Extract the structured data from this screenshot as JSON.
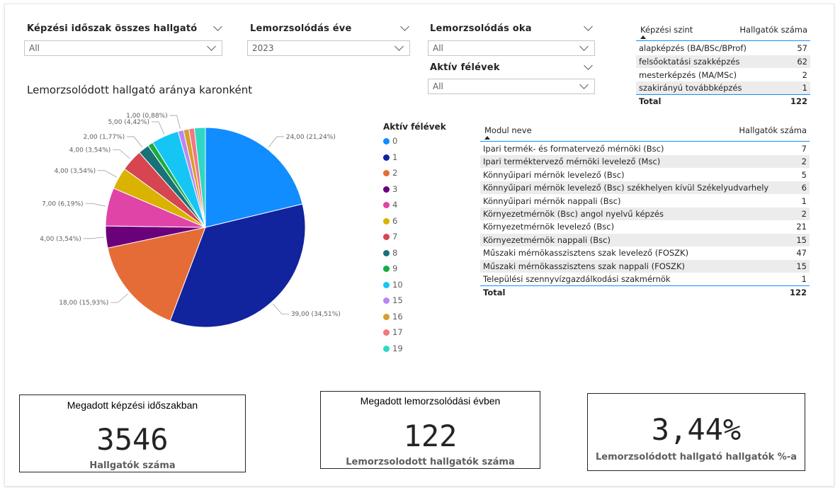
{
  "slicers": {
    "period": {
      "title": "Képzési időszak összes hallgató",
      "value": "All"
    },
    "year": {
      "title": "Lemorzsolódás éve",
      "value": "2023"
    },
    "reason": {
      "title": "Lemorzsolódás oka",
      "value": "All"
    },
    "active": {
      "title": "Aktív félévek",
      "value": "All"
    }
  },
  "level_table": {
    "col1": "Képzési szint",
    "col2": "Hallgatók száma",
    "rows": [
      {
        "name": "alapképzés (BA/BSc/BProf)",
        "value": "57"
      },
      {
        "name": "felsőoktatási szakképzés",
        "value": "62"
      },
      {
        "name": "mesterképzés (MA/MSc)",
        "value": "2"
      },
      {
        "name": "szakirányú továbbképzés",
        "value": "1"
      }
    ],
    "total_label": "Total",
    "total_value": "122"
  },
  "module_table": {
    "col1": "Modul neve",
    "col2": "Hallgatók száma",
    "rows": [
      {
        "name": "Ipari termék- és formatervező mérnöki (Bsc)",
        "value": "7"
      },
      {
        "name": "Ipari terméktervező mérnöki levelező (Msc)",
        "value": "2"
      },
      {
        "name": "Könnyűipari mérnök levelező (Bsc)",
        "value": "5"
      },
      {
        "name": "Könnyűipari mérnök levelező (Bsc) székhelyen kívül Székelyudvarhely",
        "value": "6"
      },
      {
        "name": "Könnyűipari mérnök nappali (Bsc)",
        "value": "1"
      },
      {
        "name": "Környezetmérnök (Bsc) angol nyelvű képzés",
        "value": "2"
      },
      {
        "name": "Környezetmérnök levelező (Bsc)",
        "value": "21"
      },
      {
        "name": "Környezetmérnök nappali (Bsc)",
        "value": "15"
      },
      {
        "name": "Műszaki mérnökasszisztens szak levelező (FOSZK)",
        "value": "47"
      },
      {
        "name": "Műszaki mérnökasszisztens szak nappali (FOSZK)",
        "value": "15"
      },
      {
        "name": "Települési szennyvízgazdálkodási szakmérnök",
        "value": "1"
      }
    ],
    "total_label": "Total",
    "total_value": "122"
  },
  "cards": {
    "c1": {
      "title": "Megadott képzési időszakban",
      "value": "3546",
      "subtitle": "Hallgatók száma"
    },
    "c2": {
      "title": "Megadott lemorzsolódási évben",
      "value": "122",
      "subtitle": "Lemorzsolodott hallgatók száma"
    },
    "c3": {
      "value": "3,44%",
      "subtitle": "Lemorzsolódott hallgató hallgatók %-a"
    }
  },
  "chart_data": {
    "type": "pie",
    "title": "Lemorzsolódott hallgató aránya karonként",
    "legend_title": "Aktív félévek",
    "legend_position": "right",
    "slices": [
      {
        "name": "0",
        "value": 24,
        "label": "24,00 (21,24%)",
        "color": "#118DFF"
      },
      {
        "name": "1",
        "value": 39,
        "label": "39,00 (34,51%)",
        "color": "#12239E"
      },
      {
        "name": "2",
        "value": 18,
        "label": "18,00 (15,93%)",
        "color": "#E66C37"
      },
      {
        "name": "3",
        "value": 4,
        "label": "4,00 (3,54%)",
        "color": "#6B007B"
      },
      {
        "name": "4",
        "value": 7,
        "label": "7,00 (6,19%)",
        "color": "#E044A7"
      },
      {
        "name": "6",
        "value": 4,
        "label": "4,00 (3,54%)",
        "color": "#D9B300"
      },
      {
        "name": "7",
        "value": 4,
        "label": "4,00 (3,54%)",
        "color": "#D64550"
      },
      {
        "name": "8",
        "value": 2,
        "label": "2,00 (1,77%)",
        "color": "#197278"
      },
      {
        "name": "9",
        "value": 1,
        "label": "",
        "color": "#1AAB40"
      },
      {
        "name": "10",
        "value": 5,
        "label": "5,00 (4,42%)",
        "color": "#15C6F4"
      },
      {
        "name": "15",
        "value": 1,
        "label": "1,00 (0,88%)",
        "color": "#B887F4"
      },
      {
        "name": "16",
        "value": 1,
        "label": "",
        "color": "#D69E30"
      },
      {
        "name": "17",
        "value": 1,
        "label": "",
        "color": "#F2777F"
      },
      {
        "name": "19",
        "value": 2,
        "label": "",
        "color": "#2ED8C5"
      }
    ]
  }
}
